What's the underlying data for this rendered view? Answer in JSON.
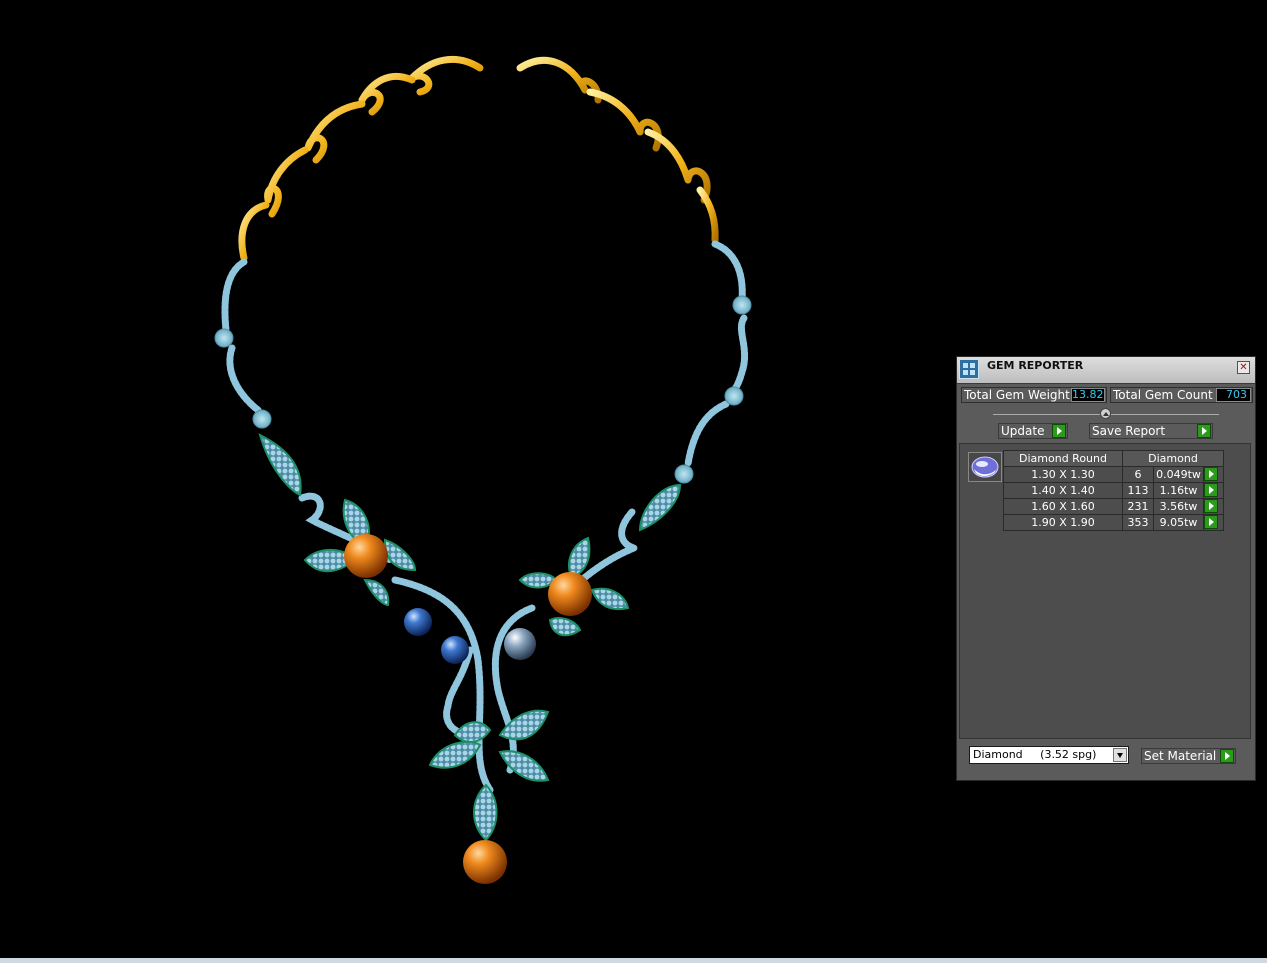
{
  "viewport": {
    "label": "jewelry-3d-viewport",
    "icon": "necklace-render"
  },
  "panel": {
    "title": "GEM REPORTER",
    "icon": "gem-reporter-icon",
    "total_weight_label": "Total Gem Weight",
    "total_weight_value": "13.82",
    "total_count_label": "Total Gem Count",
    "total_count_value": "703",
    "update_label": "Update",
    "save_report_label": "Save Report",
    "table": {
      "header_type": "Diamond Round",
      "header_material": "Diamond",
      "rows": [
        {
          "size": "1.30 X 1.30",
          "count": "6",
          "weight": "0.049tw"
        },
        {
          "size": "1.40 X 1.40",
          "count": "113",
          "weight": "1.16tw"
        },
        {
          "size": "1.60 X 1.60",
          "count": "231",
          "weight": "3.56tw"
        },
        {
          "size": "1.90 X 1.90",
          "count": "353",
          "weight": "9.05tw"
        }
      ]
    },
    "material_selected": "Diamond     (3.52 spg)",
    "set_material_label": "Set Material"
  },
  "colors": {
    "gold": "#f2b21a",
    "pave": "#8fc6dd",
    "leaf_edge": "#1c8f66",
    "orange_pearl": "#e8760e",
    "blue_pearl": "#3a6fc8",
    "panel_bg": "#5b5b5b",
    "value_cyan": "#36c8f0",
    "go_green": "#2d9a1e"
  }
}
